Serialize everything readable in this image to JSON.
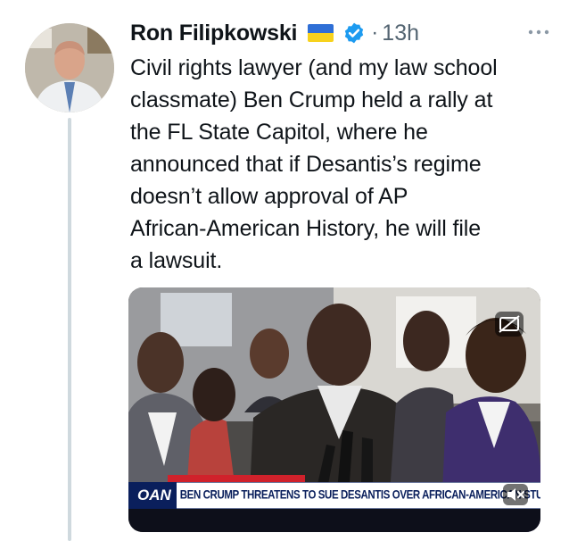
{
  "tweet": {
    "author_name": "Ron Filipkowski",
    "separator": "·",
    "time": "13h",
    "text": "Civil rights lawyer (and my law school\nclassmate) Ben Crump held a rally at\nthe FL State Capitol, where he\nannounced that if Desantis’s regime\ndoesn’t allow approval of AP\nAfrican-American History, he will file\na lawsuit.",
    "icons": {
      "flag": "ukraine-flag-icon",
      "verified": "verified-badge-icon",
      "more": "more-options-icon"
    }
  },
  "video": {
    "network_logo": "OAN",
    "chyron": "BEN CRUMP THREATENS TO SUE DESANTIS OVER AFRICAN-AMERICAN STUDIES CO",
    "icons": {
      "captions": "closed-captions-icon",
      "mute": "volume-muted-icon"
    }
  },
  "colors": {
    "verified": "#1d9bf0",
    "secondary_text": "#536471",
    "thread_line": "#cfd9de",
    "chyron_navy": "#0a1f5c",
    "chyron_red": "#d0212b"
  }
}
